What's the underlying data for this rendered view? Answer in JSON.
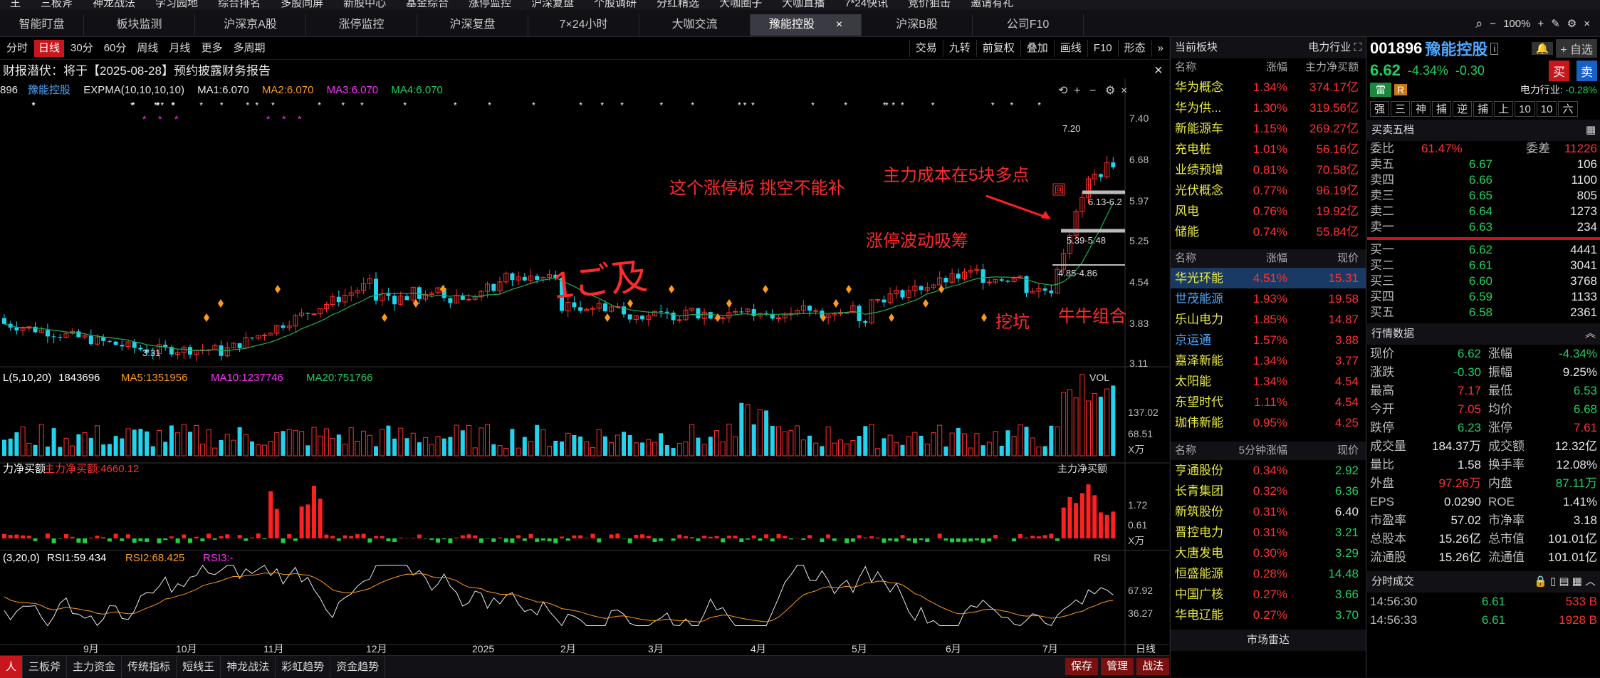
{
  "topbar": [
    "王",
    "三板斧",
    "神龙战法",
    "学习园地",
    "综合排名",
    "多股同屏",
    "新股中心",
    "基金综合",
    "涨停监控",
    "沪深复盘",
    "个股调研",
    "分红精选",
    "大咖圈子",
    "大咖直播",
    "7*24快讯",
    "竞价狙击",
    "邀请有礼"
  ],
  "tabs": [
    "智能盯盘",
    "板块监测",
    "沪深京A股",
    "涨停监控",
    "沪深复盘",
    "7×24小时",
    "大咖交流",
    "豫能控股",
    "沪深B股",
    "公司F10"
  ],
  "tab_close": "×",
  "tab_right": {
    "zoom": "100%",
    "plus": "+",
    "minus": "−",
    "gear": "⚙",
    "close": "×"
  },
  "toolbar": {
    "periods": [
      "分时",
      "日线",
      "30分",
      "60分",
      "周线",
      "月线",
      "更多",
      "多周期"
    ],
    "selected": "日线",
    "right": [
      "交易",
      "九转",
      "前复权",
      "叠加",
      "画线",
      "F10",
      "形态"
    ]
  },
  "notice": "财报潜伏：将于【2025-08-28】预约披露财务报告",
  "legend1": {
    "code": "896",
    "name": "豫能控股",
    "expma": "EXPMA(10,10,10,10)",
    "ma1": "MA1:6.070",
    "ma2": "MA2:6.070",
    "ma3": "MA3:6.070",
    "ma4": "MA4:6.070"
  },
  "price_axis": [
    "7.40",
    "6.68",
    "5.97",
    "5.25",
    "4.54",
    "3.83",
    "3.11"
  ],
  "price_labels": {
    "high": "7.20",
    "low": "3.31",
    "z1": "6.13-6.2",
    "z2": "5.39-5.48",
    "z3": "4.85-4.86",
    "mark": "回"
  },
  "annotations": {
    "a1": "这个涨停板 挑空不能补",
    "a2": "主力成本在5块多点",
    "a3": "涨停波动吸筹",
    "a4": "挖坑",
    "a5": "牛牛组合",
    "a6": "1ご及"
  },
  "vol": {
    "title": "L(5,10,20)",
    "v": "1843696",
    "ma5": "MA5:1351956",
    "ma10": "MA10:1237746",
    "ma20": "MA20:751766",
    "label": "VOL",
    "ticks": [
      "137.02",
      "68.51"
    ],
    "unit": "X万"
  },
  "flow": {
    "title": "力净买额",
    "v": "主力净买额:4660.12",
    "label": "主力净买额",
    "ticks": [
      "1.72",
      "0.61"
    ],
    "unit": "X万"
  },
  "rsi": {
    "title": "(3,20,0)",
    "r1": "RSI1:59.434",
    "r2": "RSI2:68.425",
    "r3": "RSI3:-",
    "label": "RSI",
    "ticks": [
      "67.92",
      "36.27"
    ]
  },
  "months": [
    "9月",
    "10月",
    "11月",
    "12月",
    "2025",
    "2月",
    "3月",
    "4月",
    "5月",
    "6月",
    "7月"
  ],
  "period_label": "日线",
  "bottom": {
    "items": [
      "人",
      "三板斧",
      "主力资金",
      "传统指标",
      "短线王",
      "神龙战法",
      "彩虹趋势",
      "资金趋势"
    ],
    "right": [
      "保存",
      "管理",
      "战法"
    ]
  },
  "sectors": {
    "title": "当前板块",
    "industry": "电力行业",
    "cols": [
      "名称",
      "涨幅",
      "主力净买额"
    ],
    "rows": [
      [
        "华为概念",
        "1.34%",
        "374.17亿"
      ],
      [
        "华为供...",
        "1.30%",
        "319.56亿"
      ],
      [
        "新能源车",
        "1.15%",
        "269.27亿"
      ],
      [
        "充电桩",
        "1.01%",
        "56.16亿"
      ],
      [
        "业绩预增",
        "0.81%",
        "70.58亿"
      ],
      [
        "光伏概念",
        "0.77%",
        "96.19亿"
      ],
      [
        "风电",
        "0.76%",
        "19.92亿"
      ],
      [
        "储能",
        "0.74%",
        "55.84亿"
      ]
    ]
  },
  "peers": {
    "cols": [
      "名称",
      "涨幅",
      "现价"
    ],
    "rows": [
      [
        "华光环能",
        "4.51%",
        "15.31"
      ],
      [
        "世茂能源",
        "1.93%",
        "19.58"
      ],
      [
        "乐山电力",
        "1.85%",
        "14.87"
      ],
      [
        "京运通",
        "1.57%",
        "3.88"
      ],
      [
        "嘉泽新能",
        "1.34%",
        "3.77"
      ],
      [
        "太阳能",
        "1.34%",
        "4.54"
      ],
      [
        "东望时代",
        "1.11%",
        "4.54"
      ],
      [
        "珈伟新能",
        "0.95%",
        "4.25"
      ]
    ]
  },
  "fivemin": {
    "cols": [
      "名称",
      "5分钟涨幅",
      "现价"
    ],
    "rows": [
      [
        "亨通股份",
        "0.34%",
        "2.92"
      ],
      [
        "长青集团",
        "0.32%",
        "6.36"
      ],
      [
        "新筑股份",
        "0.31%",
        "6.40"
      ],
      [
        "晋控电力",
        "0.31%",
        "3.21"
      ],
      [
        "大唐发电",
        "0.30%",
        "3.29"
      ],
      [
        "恒盛能源",
        "0.28%",
        "14.48"
      ],
      [
        "中国广核",
        "0.27%",
        "3.66"
      ],
      [
        "华电辽能",
        "0.27%",
        "3.70"
      ]
    ],
    "footer": "市场雷达"
  },
  "stock": {
    "code": "001896",
    "name": "豫能控股",
    "price": "6.62",
    "pct": "-4.34%",
    "chg": "-0.30",
    "buy": "买",
    "sell": "卖",
    "tag1": "雷",
    "tag2": "R",
    "industry_label": "电力行业:",
    "industry_pct": "-0.28%",
    "self": "自选",
    "buttons": [
      "强",
      "三",
      "神",
      "捕",
      "逆",
      "捕",
      "上",
      "10",
      "10",
      "六"
    ]
  },
  "orderbook": {
    "title": "买卖五档",
    "wb_label": "委比",
    "wb": "61.47%",
    "wc_label": "委差",
    "wc": "11226",
    "asks": [
      [
        "卖五",
        "6.67",
        "106"
      ],
      [
        "卖四",
        "6.66",
        "1100"
      ],
      [
        "卖三",
        "6.65",
        "805"
      ],
      [
        "卖二",
        "6.64",
        "1273"
      ],
      [
        "卖一",
        "6.63",
        "234"
      ]
    ],
    "bids": [
      [
        "买一",
        "6.62",
        "4441"
      ],
      [
        "买二",
        "6.61",
        "3041"
      ],
      [
        "买三",
        "6.60",
        "3768"
      ],
      [
        "买四",
        "6.59",
        "1133"
      ],
      [
        "买五",
        "6.58",
        "2361"
      ]
    ]
  },
  "quote": {
    "title": "行情数据",
    "rows": [
      [
        "现价",
        "6.62",
        "涨幅",
        "-4.34%"
      ],
      [
        "涨跌",
        "-0.30",
        "振幅",
        "9.25%"
      ],
      [
        "最高",
        "7.17",
        "最低",
        "6.53"
      ],
      [
        "今开",
        "7.05",
        "均价",
        "6.68"
      ],
      [
        "跌停",
        "6.23",
        "涨停",
        "7.61"
      ],
      [
        "成交量",
        "184.37万",
        "成交额",
        "12.32亿"
      ],
      [
        "量比",
        "1.58",
        "换手率",
        "12.08%"
      ],
      [
        "外盘",
        "97.26万",
        "内盘",
        "87.11万"
      ],
      [
        "EPS",
        "0.0290",
        "ROE",
        "1.41%"
      ],
      [
        "市盈率",
        "57.02",
        "市净率",
        "3.18"
      ],
      [
        "总股本",
        "15.26亿",
        "总市值",
        "101.01亿"
      ],
      [
        "流通股",
        "15.26亿",
        "流通值",
        "101.01亿"
      ]
    ]
  },
  "ticks": {
    "title": "分时成交",
    "rows": [
      [
        "14:56:30",
        "6.61",
        "533 B"
      ],
      [
        "14:56:33",
        "6.61",
        "1928 B"
      ]
    ]
  }
}
